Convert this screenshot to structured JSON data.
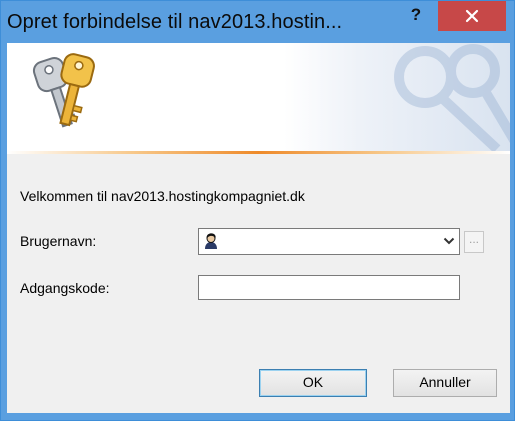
{
  "window": {
    "title": "Opret forbindelse til nav2013.hostin...",
    "help_label": "?",
    "colors": {
      "titlebar": "#5a9fe0",
      "close_button": "#c74848",
      "accent_line": "#ee8a2a"
    }
  },
  "dialog": {
    "welcome": "Velkommen til nav2013.hostingkompagniet.dk",
    "username_label": "Brugernavn:",
    "username_value": "",
    "password_label": "Adgangskode:",
    "password_value": "",
    "browse_label": "...",
    "ok_label": "OK",
    "cancel_label": "Annuller"
  },
  "icons": {
    "banner": "keys-icon",
    "username_field": "user-icon",
    "dropdown": "chevron-down-icon",
    "close": "close-icon"
  }
}
